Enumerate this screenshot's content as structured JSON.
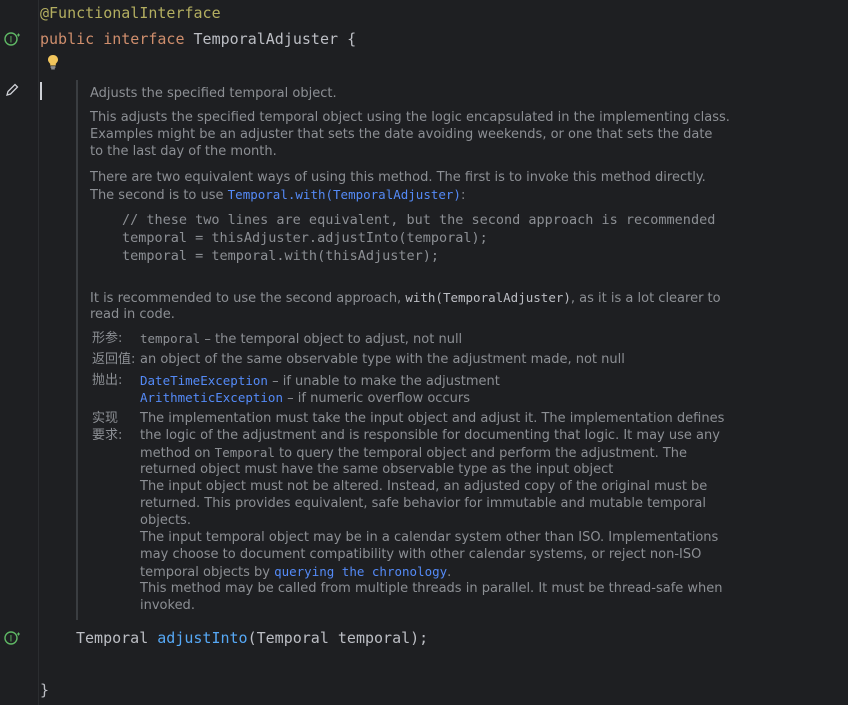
{
  "code": {
    "annotation": "@FunctionalInterface",
    "decl_kw1": "public",
    "decl_kw2": "interface",
    "decl_name": "TemporalAdjuster",
    "decl_brace": "{",
    "method_return": "Temporal",
    "method_name": "adjustInto",
    "method_params": "(Temporal temporal);",
    "closing_brace": "}"
  },
  "doc": {
    "summary": "Adjusts the specified temporal object.",
    "para1": [
      "This adjusts the specified temporal object using the logic encapsulated in the implementing class.",
      "Examples might be an adjuster that sets the date avoiding weekends, or one that sets the date",
      "to the last day of the month."
    ],
    "para2_line1": "There are two equivalent ways of using this method. The first is to invoke this method directly.",
    "para2_line2_prefix": "The second is to use ",
    "para2_link": "Temporal.with(TemporalAdjuster)",
    "para2_line2_suffix": ":",
    "code_comment": "// these two lines are equivalent, but the second approach is recommended",
    "code_line1": "temporal = thisAdjuster.adjustInto(temporal);",
    "code_line2": "temporal = temporal.with(thisAdjuster);",
    "para3_prefix": "It is recommended to use the second approach, ",
    "para3_code": "with(TemporalAdjuster)",
    "para3_suffix": ", as it is a lot clearer to",
    "para3_line2": "read in code.",
    "params_label": "形参:",
    "param_name": "temporal",
    "param_desc": " – the temporal object to adjust, not null",
    "returns_label": "返回值:",
    "returns_desc": "an object of the same observable type with the adjustment made, not null",
    "throws_label": "抛出:",
    "throws": [
      {
        "name": "DateTimeException",
        "desc": " – if unable to make the adjustment"
      },
      {
        "name": "ArithmeticException",
        "desc": " – if numeric overflow occurs"
      }
    ],
    "impl_label_1": "实现",
    "impl_label_2": "要求:",
    "impl_lines_a": [
      "The implementation must take the input object and adjust it. The implementation defines",
      "the logic of the adjustment and is responsible for documenting that logic. It may use any"
    ],
    "impl_line3_prefix": "method on ",
    "impl_line3_code": "Temporal",
    "impl_line3_suffix": " to query the temporal object and perform the adjustment. The",
    "impl_lines_b": [
      "returned object must have the same observable type as the input object",
      "The input object must not be altered. Instead, an adjusted copy of the original must be",
      "returned. This provides equivalent, safe behavior for immutable and mutable temporal",
      "objects.",
      "The input temporal object may be in a calendar system other than ISO. Implementations",
      "may choose to document compatibility with other calendar systems, or reject non-ISO"
    ],
    "impl_line10_prefix": "temporal objects by ",
    "impl_line10_link": "querying the chronology",
    "impl_line10_suffix": ".",
    "impl_lines_c": [
      "This method may be called from multiple threads in parallel. It must be thread-safe when",
      "invoked."
    ]
  }
}
